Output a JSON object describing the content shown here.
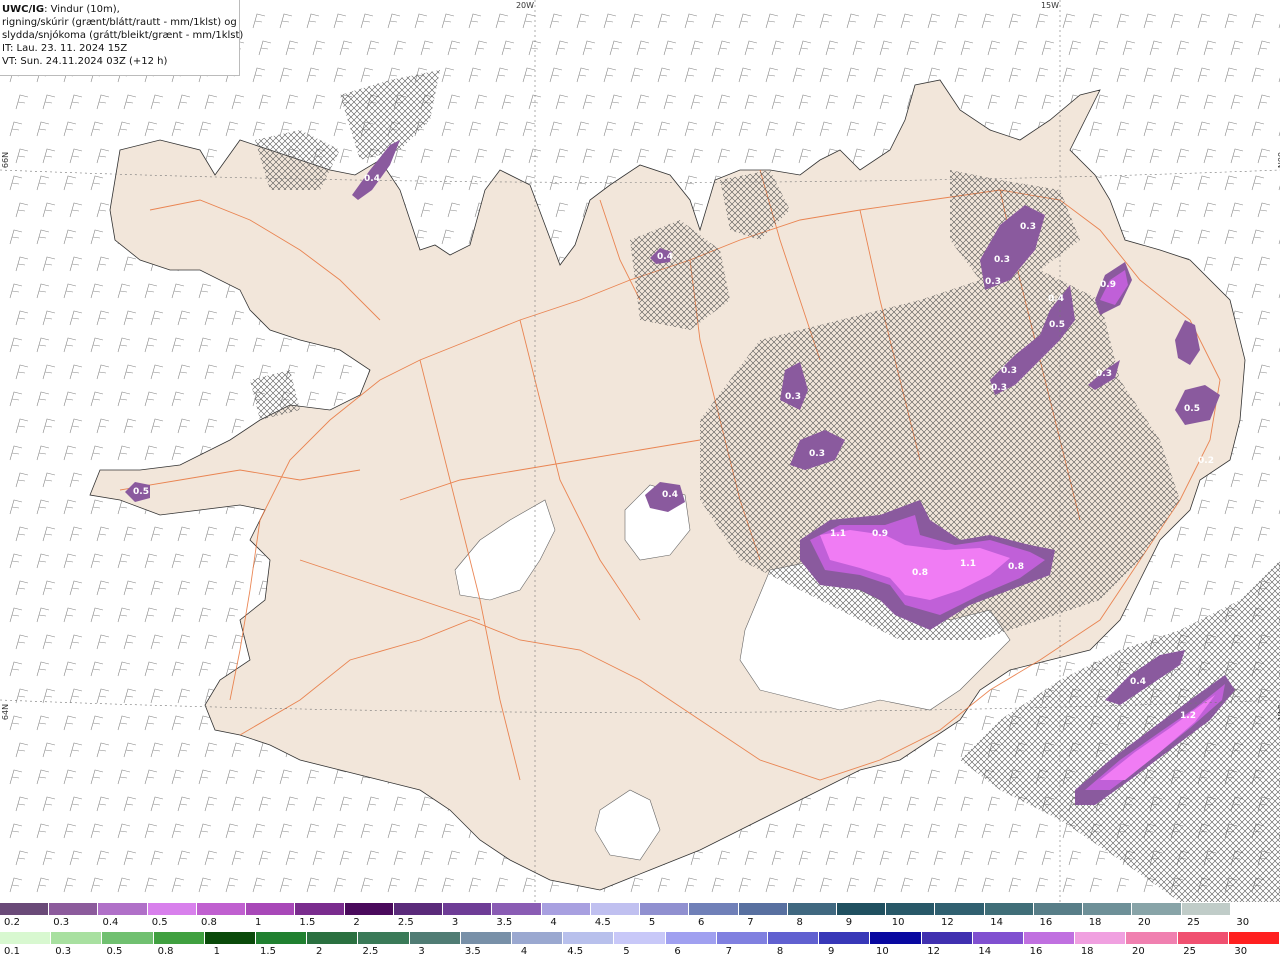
{
  "header": {
    "line1_bold": "UWC/IG",
    "line1_rest": ": Vindur (10m),",
    "line2": "rigning/skúrir (grænt/blátt/rautt - mm/1klst) og",
    "line3": "slydda/snjókoma (grátt/bleikt/grænt - mm/1klst)",
    "line4": "IT: Lau. 23. 11. 2024 15Z",
    "line5": "VT: Sun. 24.11.2024 03Z (+12 h)"
  },
  "graticule_labels": [
    "20W",
    "15W",
    "66N",
    "66N",
    "64N",
    "64N"
  ],
  "precip_labels": [
    "0.4",
    "0.4",
    "0.5",
    "0.3",
    "0.3",
    "0.4",
    "1.1",
    "0.9",
    "0.8",
    "1.1",
    "0.8",
    "0.3",
    "0.3",
    "0.3",
    "0.4",
    "0.5",
    "0.3",
    "0.3",
    "0.9",
    "0.3",
    "0.5",
    "0.2",
    "0.4",
    "1.2"
  ],
  "snow_scale": {
    "labels": [
      "0.2",
      "0.3",
      "0.4",
      "0.5",
      "0.8",
      "1",
      "1.5",
      "2",
      "2.5",
      "3",
      "3.5",
      "4",
      "4.5",
      "5",
      "6",
      "7",
      "8",
      "9",
      "10",
      "12",
      "14",
      "16",
      "18",
      "20",
      "25",
      "30"
    ],
    "colors": [
      "#6a4a78",
      "#8c5b9c",
      "#b070c8",
      "#d880ec",
      "#c060d0",
      "#a848b8",
      "#7a2c8e",
      "#4a0a5c",
      "#5a2a7a",
      "#6e3c96",
      "#8a5cb4",
      "#a8a0e0",
      "#c0c0f0",
      "#9090d0",
      "#7080b8",
      "#5870a0",
      "#406880",
      "#205060",
      "#285868",
      "#306070",
      "#406e78",
      "#587e88",
      "#6e9098",
      "#88a4a8",
      "#c0ccc8",
      "#ffffff"
    ]
  },
  "rain_scale": {
    "labels": [
      "0.1",
      "0.3",
      "0.5",
      "0.8",
      "1",
      "1.5",
      "2",
      "2.5",
      "3",
      "3.5",
      "4",
      "4.5",
      "5",
      "6",
      "7",
      "8",
      "9",
      "10",
      "12",
      "14",
      "16",
      "18",
      "20",
      "25",
      "30"
    ],
    "colors": [
      "#d8f8d0",
      "#a8e0a0",
      "#70c070",
      "#40a040",
      "#0a4a0a",
      "#208030",
      "#2a7040",
      "#3a7a58",
      "#507c74",
      "#7890a8",
      "#9aa8d0",
      "#b8c0ec",
      "#c8c8f8",
      "#a0a0f0",
      "#8080e0",
      "#6060d0",
      "#3838b8",
      "#0808a0",
      "#4030b0",
      "#8050d0",
      "#c070e0",
      "#f0a0e0",
      "#f080b0",
      "#f05070",
      "#ff2020"
    ]
  },
  "colors": {
    "land": "#f2e6da",
    "road": "#e8733a",
    "snow_light": "#8a5a9e",
    "snow_mid": "#c060d8",
    "snow_heavy": "#f07cf4"
  }
}
